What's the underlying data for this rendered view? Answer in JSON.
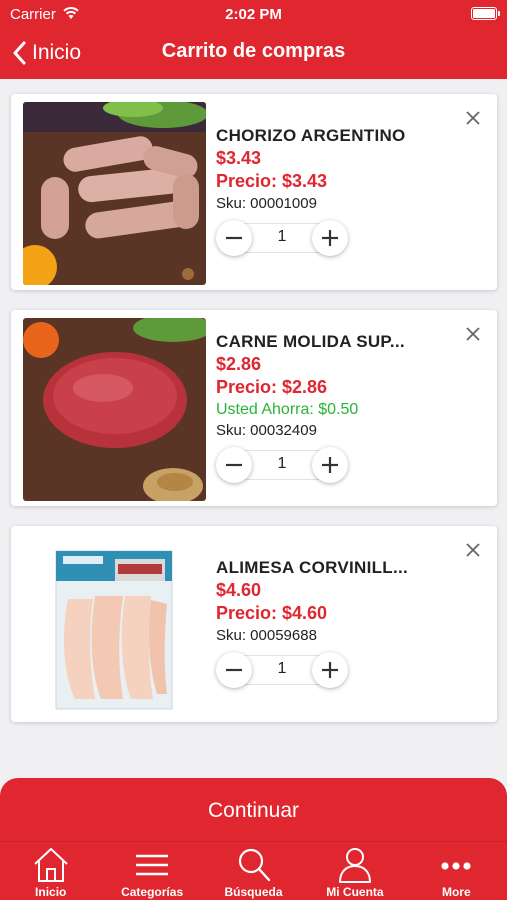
{
  "status_bar": {
    "carrier": "Carrier",
    "time": "2:02 PM"
  },
  "nav": {
    "back_label": "Inicio",
    "title": "Carrito de compras"
  },
  "colors": {
    "brand_red": "#e0262f",
    "savings_green": "#27b536"
  },
  "items": [
    {
      "name": "CHORIZO ARGENTINO",
      "price": "$3.43",
      "precio": "Precio: $3.43",
      "sku": "Sku: 00001009",
      "qty": "1",
      "image": "sausages-on-board"
    },
    {
      "name": "CARNE MOLIDA SUP...",
      "price": "$2.86",
      "precio": "Precio: $2.86",
      "ahorra": "Usted Ahorra: $0.50",
      "sku": "Sku: 00032409",
      "qty": "1",
      "image": "ground-beef-on-board"
    },
    {
      "name": "ALIMESA CORVINILL...",
      "price": "$4.60",
      "precio": "Precio: $4.60",
      "sku": "Sku: 00059688",
      "qty": "1",
      "image": "fish-fillet-package"
    }
  ],
  "continue_label": "Continuar",
  "tabs": [
    {
      "label": "Inicio",
      "icon": "home-icon"
    },
    {
      "label": "Categorías",
      "icon": "menu-icon"
    },
    {
      "label": "Búsqueda",
      "icon": "search-icon"
    },
    {
      "label": "Mi Cuenta",
      "icon": "user-icon"
    },
    {
      "label": "More",
      "icon": "more-icon"
    }
  ]
}
